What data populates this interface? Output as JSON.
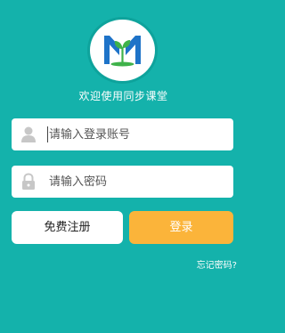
{
  "app": {
    "welcome": "欢迎使用同步课堂"
  },
  "form": {
    "account_placeholder": "请输入登录账号",
    "password_placeholder": "请输入密码",
    "register_label": "免费注册",
    "login_label": "登录",
    "forgot_label": "忘记密码?"
  },
  "icons": {
    "logo": "book-sprout-logo",
    "account": "user-icon",
    "password": "lock-icon"
  },
  "colors": {
    "background": "#14b2ab",
    "login_button": "#fbb43a",
    "logo_blue": "#1e73c8",
    "logo_green": "#3fb24a"
  }
}
